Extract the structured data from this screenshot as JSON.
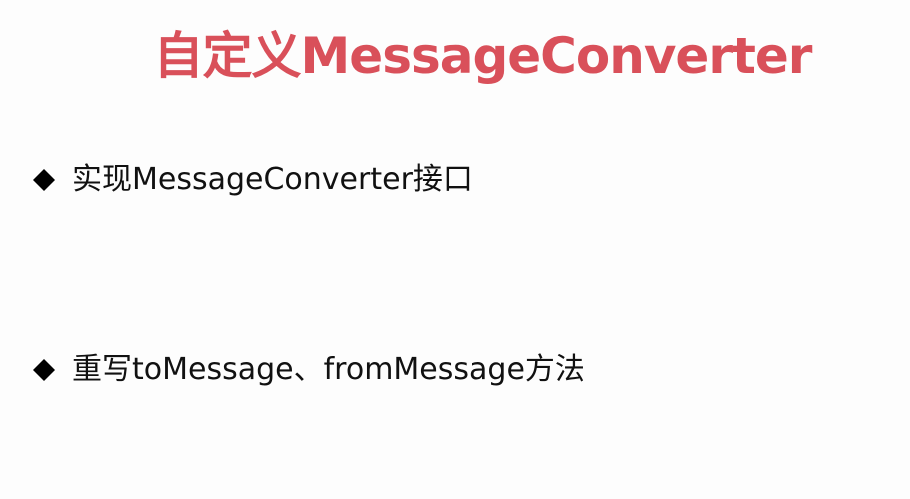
{
  "slide": {
    "title": "自定义MessageConverter",
    "bullets": [
      {
        "icon": "diamond-bullet-icon",
        "text": "实现MessageConverter接口"
      },
      {
        "icon": "diamond-bullet-icon",
        "text": "重写toMessage、fromMessage方法"
      }
    ]
  },
  "colors": {
    "title": "#d9505a",
    "text": "#111111",
    "background": "#fdfdfd"
  }
}
